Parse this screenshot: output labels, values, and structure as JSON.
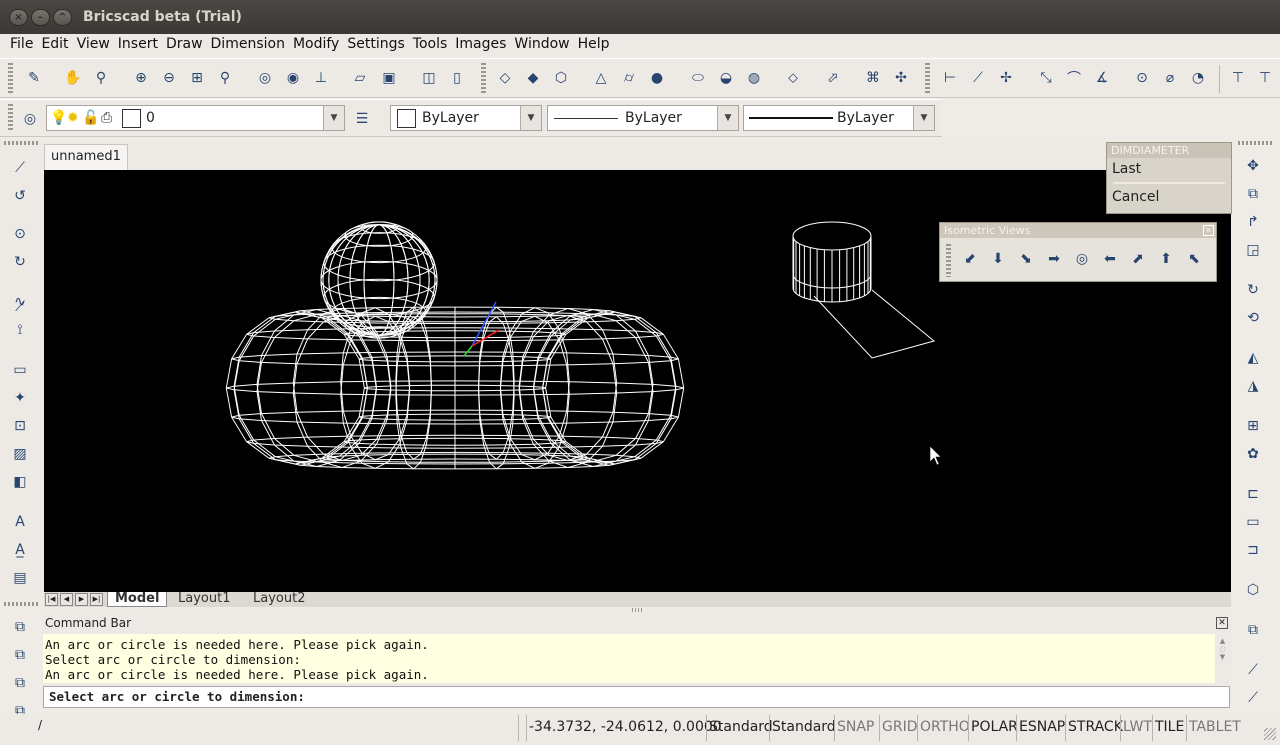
{
  "window": {
    "title": "Bricscad beta (Trial)"
  },
  "menu": [
    "File",
    "Edit",
    "View",
    "Insert",
    "Draw",
    "Dimension",
    "Modify",
    "Settings",
    "Tools",
    "Images",
    "Window",
    "Help"
  ],
  "properties": {
    "layer": "0",
    "color": "ByLayer",
    "linetype": "ByLayer",
    "lineweight": "ByLayer"
  },
  "document_tab": "unnamed1",
  "layout_tabs": [
    "Model",
    "Layout1",
    "Layout2"
  ],
  "context_menu": {
    "title": "DIMDIAMETER",
    "items": [
      "Last",
      "Cancel"
    ]
  },
  "isometric_views": {
    "title": "Isometric Views"
  },
  "command_bar": {
    "title": "Command Bar",
    "history": [
      "An arc or circle is needed here. Please pick again.",
      "Select arc or circle to dimension:",
      "An arc or circle is needed here. Please pick again."
    ],
    "prompt": "Select arc or circle to dimension:"
  },
  "status": {
    "left_text": "/",
    "coords": "-34.3732, -24.0612, 0.0000",
    "text_style": "Standard",
    "dim_style": "Standard",
    "toggles": [
      {
        "label": "SNAP",
        "on": false
      },
      {
        "label": "GRID",
        "on": false
      },
      {
        "label": "ORTHO",
        "on": false
      },
      {
        "label": "POLAR",
        "on": true
      },
      {
        "label": "ESNAP",
        "on": true
      },
      {
        "label": "STRACK",
        "on": true
      },
      {
        "label": "LWT",
        "on": false
      },
      {
        "label": "TILE",
        "on": true
      },
      {
        "label": "TABLET",
        "on": false
      }
    ]
  }
}
